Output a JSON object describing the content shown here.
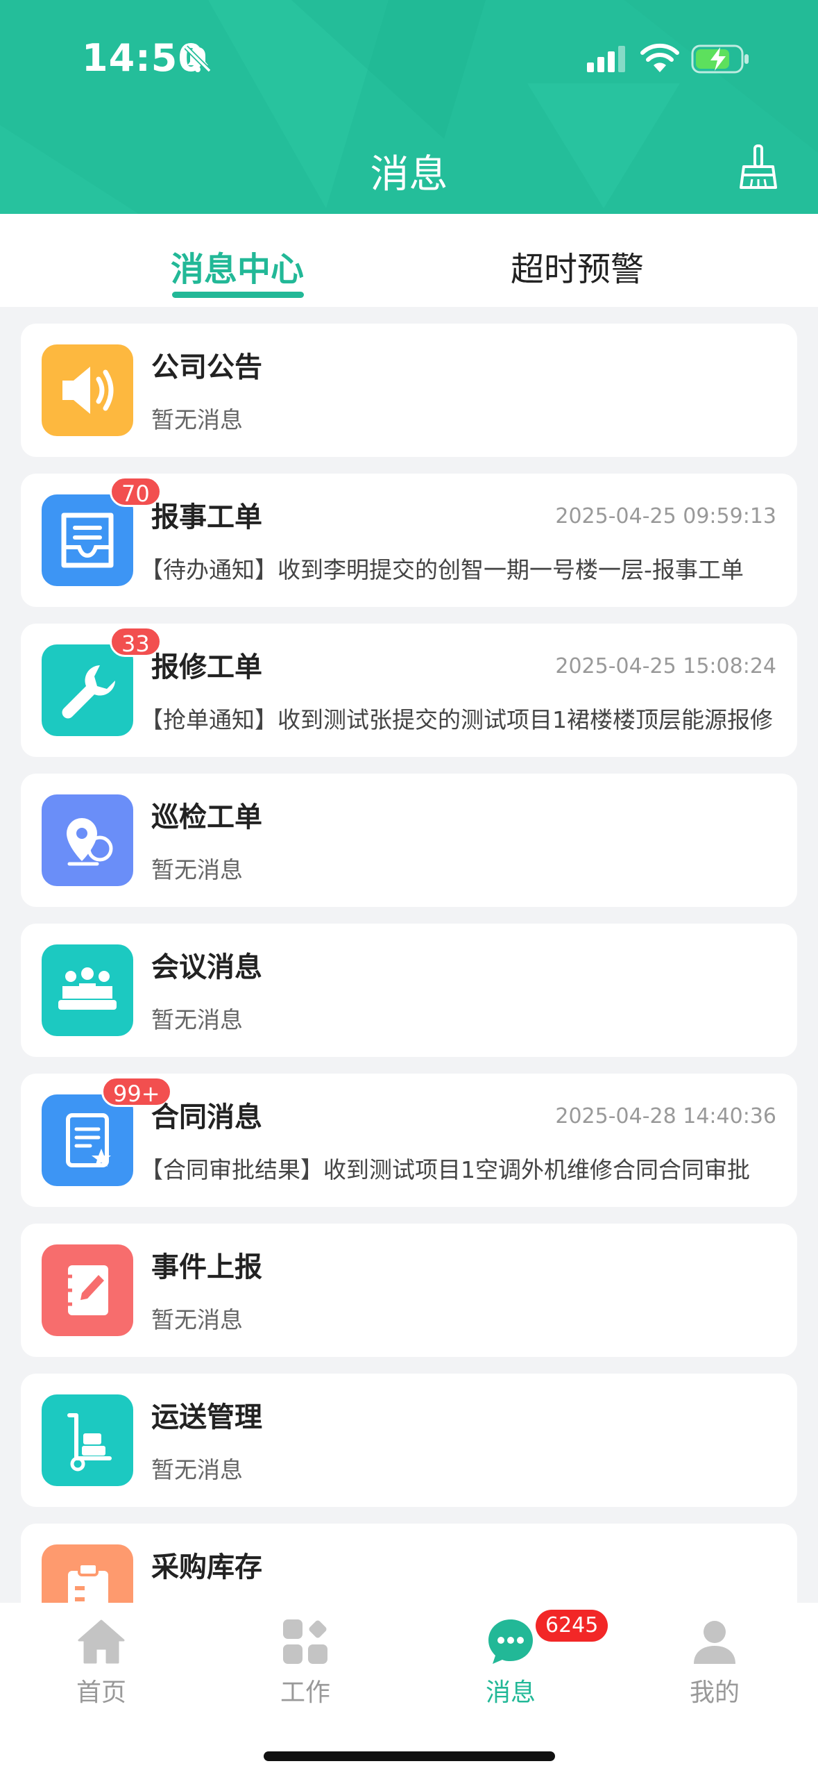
{
  "status_bar": {
    "time": "14:50"
  },
  "header": {
    "title": "消息"
  },
  "tabs": [
    {
      "label": "消息中心",
      "active": true
    },
    {
      "label": "超时预警",
      "active": false
    }
  ],
  "items": [
    {
      "title": "公司公告",
      "subtitle": "暂无消息",
      "time": "",
      "badge": "",
      "color": "#fdb83f",
      "icon": "speaker-icon"
    },
    {
      "title": "报事工单",
      "subtitle": "【待办通知】收到李明提交的创智一期一号楼一层-报事工单",
      "time": "2025-04-25 09:59:13",
      "badge": "70",
      "color": "#3d95f4",
      "icon": "inbox-tray-icon"
    },
    {
      "title": "报修工单",
      "subtitle": "【抢单通知】收到测试张提交的测试项目1裙楼楼顶层能源报修",
      "time": "2025-04-25 15:08:24",
      "badge": "33",
      "color": "#1cc9c1",
      "icon": "wrench-icon"
    },
    {
      "title": "巡检工单",
      "subtitle": "暂无消息",
      "time": "",
      "badge": "",
      "color": "#6a8ef8",
      "icon": "location-pin-icon"
    },
    {
      "title": "会议消息",
      "subtitle": "暂无消息",
      "time": "",
      "badge": "",
      "color": "#1cc9c1",
      "icon": "meeting-people-icon"
    },
    {
      "title": "合同消息",
      "subtitle": "【合同审批结果】收到测试项目1空调外机维修合同合同审批",
      "time": "2025-04-28 14:40:36",
      "badge": "99+",
      "color": "#3d95f4",
      "icon": "contract-document-icon"
    },
    {
      "title": "事件上报",
      "subtitle": "暂无消息",
      "time": "",
      "badge": "",
      "color": "#f76d6d",
      "icon": "notebook-pen-icon"
    },
    {
      "title": "运送管理",
      "subtitle": "暂无消息",
      "time": "",
      "badge": "",
      "color": "#1cc9c1",
      "icon": "hand-truck-icon"
    },
    {
      "title": "采购库存",
      "subtitle": "",
      "time": "",
      "badge": "",
      "color": "#fe9a6e",
      "icon": "clipboard-icon"
    }
  ],
  "bottom_nav": [
    {
      "label": "首页",
      "icon": "home-icon",
      "active": false
    },
    {
      "label": "工作",
      "icon": "apps-grid-icon",
      "active": false
    },
    {
      "label": "消息",
      "icon": "chat-bubble-icon",
      "active": true,
      "badge": "6245"
    },
    {
      "label": "我的",
      "icon": "user-icon",
      "active": false
    }
  ],
  "colors": {
    "primary": "#24be9a",
    "badge": "#f24f4f"
  }
}
